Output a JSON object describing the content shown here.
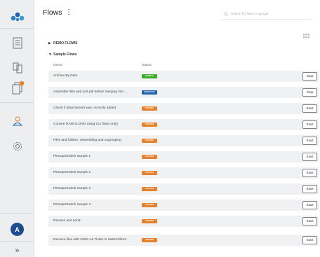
{
  "colors": {
    "running": "#3cab2a",
    "scheduled": "#1f62a9",
    "stopped": "#e6812b",
    "accent": "#1f4d8e"
  },
  "sidebar": {
    "avatar_letter": "A",
    "expand_glyph": "»"
  },
  "header": {
    "title": "Flows",
    "menu_glyph": "⋮",
    "search_placeholder": "Search for flows or groups"
  },
  "groups": {
    "demo": {
      "label": "DEMO FLOWS",
      "arrow": "▶"
    },
    "sample": {
      "label": "Sample Flows",
      "arrow": "▼"
    }
  },
  "columns": {
    "name": "Name",
    "status": "Status"
  },
  "flows": [
    {
      "name": "Archive By Date",
      "status": "RUNNING",
      "status_color": "#3cab2a",
      "action": "Stop"
    },
    {
      "name": "Assemble files and sort job before merging into ...",
      "status": "SCHEDULED",
      "status_color": "#1f62a9",
      "action": "Stop"
    },
    {
      "name": "Check if attachement was correctly added",
      "status": "STOPPED",
      "status_color": "#e6812b",
      "action": "Start"
    },
    {
      "name": "Convert RAW to DNG using CLI (Mac only)",
      "status": "STOPPED",
      "status_color": "#e6812b",
      "action": "Start"
    },
    {
      "name": "Files and folders, assembling and ungrouping",
      "status": "STOPPED",
      "status_color": "#e6812b",
      "action": "Start"
    },
    {
      "name": "PitStop2Switch sample 1",
      "status": "STOPPED",
      "status_color": "#e6812b",
      "action": "Start"
    },
    {
      "name": "PitStop2Switch sample 2",
      "status": "STOPPED",
      "status_color": "#e6812b",
      "action": "Start"
    },
    {
      "name": "PitStop2Switch sample 3",
      "status": "STOPPED",
      "status_color": "#e6812b",
      "action": "Start"
    },
    {
      "name": "PitStop2Switch sample 4",
      "status": "STOPPED",
      "status_color": "#e6812b",
      "action": "Start"
    },
    {
      "name": "Receive and send",
      "status": "STOPPED",
      "status_color": "#e6812b",
      "action": "Start"
    },
    {
      "name": "Receive files with GWG Ad Ticket in SwitchClient",
      "status": "STOPPED",
      "status_color": "#e6812b",
      "action": "Start"
    }
  ]
}
